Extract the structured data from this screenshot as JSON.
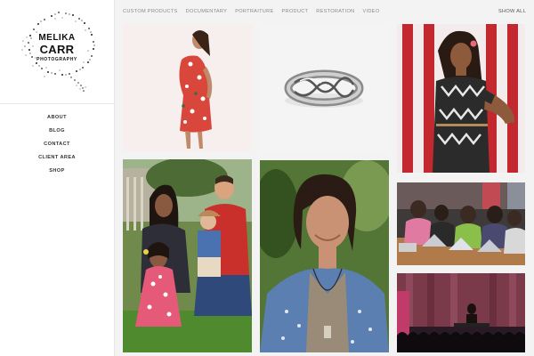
{
  "brand": {
    "line1": "MELIKA",
    "line2": "CARR",
    "line3": "PHOTOGRAPHY"
  },
  "sidebar": {
    "items": [
      {
        "label": "ABOUT"
      },
      {
        "label": "BLOG"
      },
      {
        "label": "CONTACT"
      },
      {
        "label": "CLIENT AREA"
      },
      {
        "label": "SHOP"
      }
    ]
  },
  "filters": {
    "items": [
      {
        "label": "CUSTOM PRODUCTS"
      },
      {
        "label": "DOCUMENTARY"
      },
      {
        "label": "PORTRAITURE"
      },
      {
        "label": "PRODUCT"
      },
      {
        "label": "RESTORATION"
      },
      {
        "label": "VIDEO"
      }
    ],
    "show_all": "SHOW ALL"
  },
  "colors": {
    "page_background": "#f3f3f3",
    "sidebar_background": "#ffffff",
    "nav_text": "#333333",
    "filter_text": "#8a8a8a"
  },
  "gallery": {
    "photos": [
      {
        "name": "woman-floral-dress-photo"
      },
      {
        "name": "silver-braided-ring-photo"
      },
      {
        "name": "woman-flag-backdrop-photo"
      },
      {
        "name": "family-portrait-photo"
      },
      {
        "name": "woman-denim-shirt-photo"
      },
      {
        "name": "laptop-workshop-photo"
      },
      {
        "name": "stage-performance-photo"
      }
    ]
  }
}
